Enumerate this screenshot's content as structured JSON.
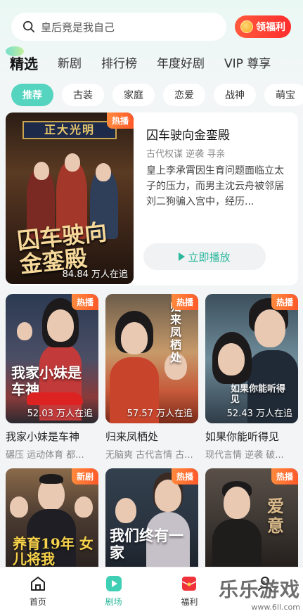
{
  "search": {
    "placeholder_text": "皇后竟是我自己",
    "welfare_label": "领福利"
  },
  "top_tabs": [
    "精选",
    "新剧",
    "排行榜",
    "年度好剧",
    "VIP 尊享"
  ],
  "chips": [
    "推荐",
    "古装",
    "家庭",
    "恋爱",
    "战神",
    "萌宝"
  ],
  "hero": {
    "badge": "热播",
    "poster_sign": "正大光明",
    "poster_title": "囚车驶向金銮殿",
    "views": "84.84 万人在追",
    "title": "囚车驶向金銮殿",
    "tags": "古代权谋  逆袭  寻亲",
    "description": "皇上李承霄因生育问题面临立太子的压力，而男主沈云舟被邻居刘二狗骗入宫中，经历...",
    "play_label": "立即播放"
  },
  "cards": [
    {
      "badge": "热播",
      "poster_text": "我家小妹是车神",
      "views": "52.03 万人在追",
      "title": "我家小妹是车神",
      "tags": "碾压  运动体育  都..."
    },
    {
      "badge": "热播",
      "poster_text": "归来凤栖处",
      "views": "57.57 万人在追",
      "title": "归来凤栖处",
      "tags": "无脑爽  古代言情  古..."
    },
    {
      "badge": "热播",
      "poster_text": "如果你能听得见",
      "views": "52.43 万人在追",
      "title": "如果你能听得见",
      "tags": "现代言情  逆袭  破..."
    },
    {
      "badge": "新剧",
      "poster_text": "养育19年 女儿将我"
    },
    {
      "badge": "热播",
      "poster_text": "我们终有一家"
    },
    {
      "badge": "热播",
      "poster_text": "爱意"
    }
  ],
  "bottom_nav": [
    {
      "label": "首页",
      "icon": "home-icon"
    },
    {
      "label": "剧场",
      "icon": "theater-play-icon",
      "active": true
    },
    {
      "label": "福利",
      "icon": "gift-envelope-icon"
    },
    {
      "label": "",
      "icon": "profile-icon"
    }
  ],
  "watermark": {
    "main": "乐乐游戏",
    "sub": "www.6ll.com"
  },
  "colors": {
    "accent": "#55d4bf",
    "play_text": "#2ab79c",
    "badge": "#ff6a33",
    "welfare": "#ff3d2d"
  }
}
